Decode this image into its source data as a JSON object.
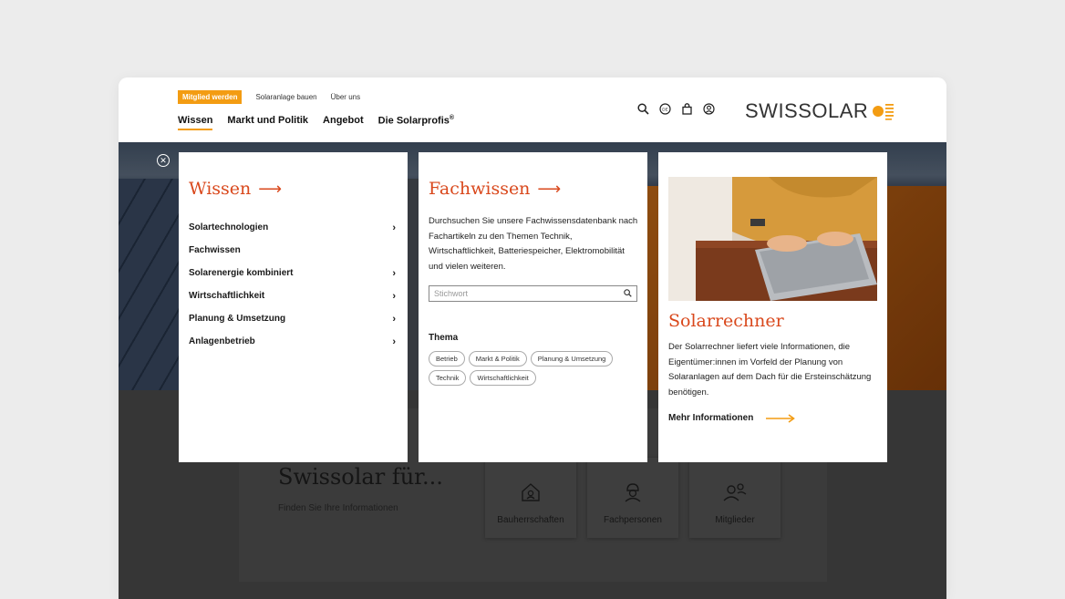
{
  "top_nav": {
    "badge": "Mitglied werden",
    "link1": "Solaranlage bauen",
    "link2": "Über uns"
  },
  "main_nav": {
    "wissen": "Wissen",
    "markt": "Markt und Politik",
    "angebot": "Angebot",
    "solarprofis": "Die Solarprofis",
    "solarprofis_mark": "®"
  },
  "header_icons": [
    "search-icon",
    "language-icon",
    "bag-icon",
    "user-icon"
  ],
  "language_icon_text": "DE",
  "logo": {
    "text": "SWISSOLAR",
    "color": "#f39c12"
  },
  "colors": {
    "accent": "#f39c12",
    "title_red": "#d9481c"
  },
  "background_section": {
    "title": "Swissolar für...",
    "subtitle": "Finden Sie Ihre Informationen",
    "tiles": [
      "Bauherrschaften",
      "Fachpersonen",
      "Mitglieder"
    ]
  },
  "panel_wissen": {
    "title": "Wissen",
    "arrow": "⟶",
    "items": [
      {
        "label": "Solartechnologien",
        "chevron": "›"
      },
      {
        "label": "Fachwissen",
        "chevron": ""
      },
      {
        "label": "Solarenergie kombiniert",
        "chevron": "›"
      },
      {
        "label": "Wirtschaftlichkeit",
        "chevron": "›"
      },
      {
        "label": "Planung & Umsetzung",
        "chevron": "›"
      },
      {
        "label": "Anlagenbetrieb",
        "chevron": "›"
      }
    ]
  },
  "panel_fachwissen": {
    "title": "Fachwissen",
    "arrow": "⟶",
    "description": "Durchsuchen Sie unsere Fachwissensdatenbank nach Fachartikeln zu den Themen Technik, Wirtschaftlichkeit, Batteriespeicher, Elektromobilität und vielen weiteren.",
    "search_placeholder": "Stichwort",
    "thema_label": "Thema",
    "tags": [
      "Betrieb",
      "Markt & Politik",
      "Planung & Umsetzung",
      "Technik",
      "Wirtschaftlichkeit"
    ]
  },
  "panel_solarrechner": {
    "title": "Solarrechner",
    "description": "Der Solarrechner liefert viele Informationen, die Eigentümer:innen im Vorfeld der Planung von Solaranlagen auf dem Dach für die Ersteinschätzung benötigen.",
    "more_label": "Mehr Informationen"
  }
}
